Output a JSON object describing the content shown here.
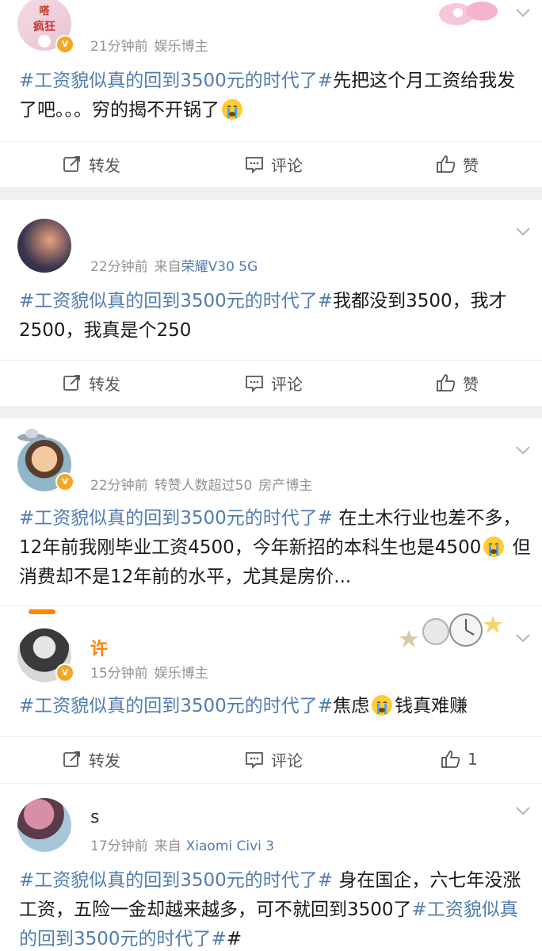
{
  "colors": {
    "link": "#507daf",
    "meta": "#939393",
    "verified": "#f6a623",
    "orange_name": "#ff8200",
    "separator": "#f0f0f0"
  },
  "posts": [
    {
      "user": {
        "name": ""
      },
      "meta": {
        "time": "21分钟前",
        "extra": "娱乐博主"
      },
      "content": {
        "hashtag": "#工资貌似真的回到3500元的时代了#",
        "text": "先把这个月工资给我发了吧。。。穷的揭不开锅了"
      },
      "actions": {
        "repost": "转发",
        "comment": "评论",
        "like": "赞"
      }
    },
    {
      "user": {
        "name": ""
      },
      "meta": {
        "time": "22分钟前",
        "source_prefix": "来自",
        "source": "荣耀V30 5G"
      },
      "content": {
        "hashtag": "#工资貌似真的回到3500元的时代了#",
        "text": "我都没到3500，我才2500，我真是个250"
      },
      "actions": {
        "repost": "转发",
        "comment": "评论",
        "like": "赞"
      }
    },
    {
      "user": {
        "name": ""
      },
      "meta": {
        "time": "22分钟前",
        "extra1": "转赞人数超过50",
        "extra2": "房产博主"
      },
      "content": {
        "hashtag": "#工资貌似真的回到3500元的时代了#",
        "text_before": " 在土木行业也差不多，12年前我刚毕业工资4500，今年新招的本科生也是4500",
        "text_after": " 但消费却不是12年前的水平，尤其是房价..."
      }
    },
    {
      "user": {
        "name": "许"
      },
      "meta": {
        "time": "15分钟前",
        "extra": "娱乐博主"
      },
      "content": {
        "hashtag": "#工资貌似真的回到3500元的时代了#",
        "text_before": "焦虑",
        "text_after": "钱真难赚"
      },
      "actions": {
        "repost": "转发",
        "comment": "评论",
        "like_count": "1"
      }
    },
    {
      "user": {
        "name": "s"
      },
      "meta": {
        "time": "17分钟前",
        "source_prefix": "来自",
        "source": "Xiaomi Civi 3"
      },
      "content": {
        "hashtag": "#工资貌似真的回到3500元的时代了#",
        "text": " 身在国企，六七年没涨工资，五险一金却越来越多，可不就回到3500了",
        "hashtag2": "#工资貌似真的回到3500元的时代了#",
        "tail": "#"
      }
    }
  ]
}
